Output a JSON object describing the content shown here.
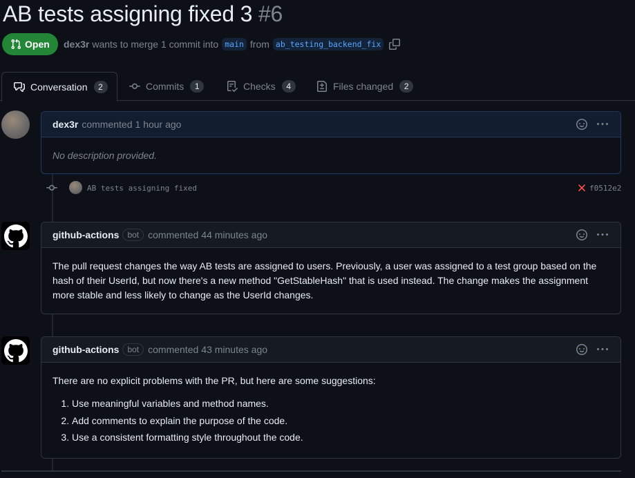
{
  "pr": {
    "title": "AB tests assigning fixed 3",
    "number": "#6",
    "state_label": "Open",
    "author": "dex3r",
    "merge_text": "wants to merge 1 commit into",
    "base_branch": "main",
    "from_text": "from",
    "head_branch": "ab_testing_backend_fix"
  },
  "tabs": [
    {
      "label": "Conversation",
      "count": "2",
      "icon": "comment-discussion-icon"
    },
    {
      "label": "Commits",
      "count": "1",
      "icon": "git-commit-icon"
    },
    {
      "label": "Checks",
      "count": "4",
      "icon": "checklist-icon"
    },
    {
      "label": "Files changed",
      "count": "2",
      "icon": "file-diff-icon"
    }
  ],
  "comments": [
    {
      "author": "dex3r",
      "action_text": "commented",
      "time": "1 hour ago",
      "body": "No description provided."
    },
    {
      "author": "github-actions",
      "badge": "bot",
      "action_text": "commented",
      "time": "44 minutes ago",
      "body": "The pull request changes the way AB tests are assigned to users. Previously, a user was assigned to a test group based on the hash of their UserId, but now there's a new method \"GetStableHash\" that is used instead. The change makes the assignment more stable and less likely to change as the UserId changes."
    },
    {
      "author": "github-actions",
      "badge": "bot",
      "action_text": "commented",
      "time": "43 minutes ago",
      "intro": "There are no explicit problems with the PR, but here are some suggestions:",
      "items": [
        "Use meaningful variables and method names.",
        "Add comments to explain the purpose of the code.",
        "Use a consistent formatting style throughout the code."
      ]
    }
  ],
  "commit": {
    "message": "AB tests assigning fixed",
    "status": "failure",
    "sha": "f0512e2"
  },
  "colors": {
    "open_green": "#238636",
    "accent_blue": "#58a6ff",
    "failure_red": "#f85149",
    "background": "#0d1117"
  }
}
